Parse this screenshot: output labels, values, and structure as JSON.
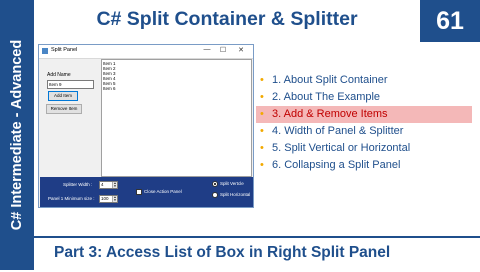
{
  "sidebar": {
    "text": "C# Intermediate - Advanced"
  },
  "header": {
    "title": "C# Split Container & Splitter",
    "episode_number": "61"
  },
  "footer": {
    "subtitle": "Part 3: Access List of Box in Right Split Panel"
  },
  "window": {
    "title": "Split Panel",
    "controls": {
      "minimize": "—",
      "maximize": "☐",
      "close": "✕"
    },
    "left_panel": {
      "add_name_label": "Add Name",
      "add_name_value": "Item 9",
      "add_button": "Add Item",
      "remove_button": "Remove Item"
    },
    "list_items": [
      "Item 1",
      "Item 2",
      "Item 3",
      "Item 4",
      "Item 5",
      "Item 6"
    ],
    "bottom": {
      "splitter_width_label": "Splitter Width :",
      "splitter_width_value": "4",
      "panel_min_label": "Panel 1 Minimum size :",
      "panel_min_value": "100",
      "close_action_label": "Close Action Panel",
      "close_action_checked": false,
      "split_vertical_label": "Split Vertcle",
      "split_vertical_selected": true,
      "split_horizontal_label": "Split Horizontal",
      "split_horizontal_selected": false
    }
  },
  "topics": [
    {
      "label": "1. About Split Container",
      "active": false
    },
    {
      "label": "2. About The Example",
      "active": false
    },
    {
      "label": "3. Add & Remove Items",
      "active": true
    },
    {
      "label": "4. Width of Panel & Splitter",
      "active": false
    },
    {
      "label": "5. Split Vertical or Horizontal",
      "active": false
    },
    {
      "label": "6. Collapsing a Split Panel",
      "active": false
    }
  ],
  "colors": {
    "brand_blue": "#1f4f8c",
    "bullet": "#f2a900",
    "highlight": "#f4b8b8",
    "highlight_text": "#c00000"
  }
}
